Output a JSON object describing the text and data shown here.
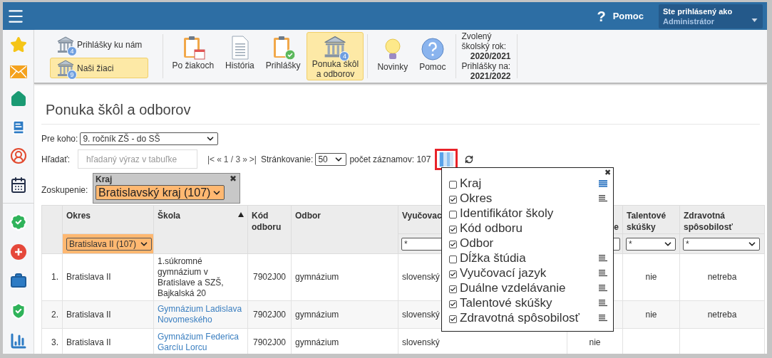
{
  "header": {
    "help_icon": "?",
    "help": "Pomoc",
    "user_label": "Ste prihlásený ako",
    "user_name": "Administrátor"
  },
  "toolbar": {
    "small_items": [
      {
        "label": "Prihlášky ku nám",
        "badge": "4",
        "selected": false
      },
      {
        "label": "Naši žiaci",
        "badge": "9",
        "selected": true
      }
    ],
    "large_items": [
      {
        "label": "Po žiakoch",
        "selected": false
      },
      {
        "label": "História",
        "selected": false
      },
      {
        "label": "Prihlášky",
        "selected": false
      },
      {
        "label": "Ponuka škôl a odborov",
        "badge": "4",
        "selected": true
      },
      {
        "label": "Novinky",
        "selected": false
      },
      {
        "label": "Pomoc",
        "selected": false
      }
    ],
    "year": {
      "label": "Zvolený školský rok:",
      "value": "2020/2021",
      "apply_label": "Prihlášky na:",
      "apply_value": "2021/2022"
    }
  },
  "page_title": "Ponuka škôl a odborov",
  "for_whom": {
    "label": "Pre koho:",
    "value": "9. ročník ZŠ - do SŠ"
  },
  "search": {
    "label": "Hľadať:",
    "placeholder": "hľadaný výraz v tabuľke"
  },
  "pager": {
    "first": "|<",
    "prev": "«",
    "pages": "1 / 3",
    "next": "»",
    "last": ">|",
    "page_size_label": "Stránkovanie:",
    "page_size": "50",
    "count": "počet záznamov: 107"
  },
  "grouping": {
    "label": "Zoskupenie:",
    "group_name": "Kraj",
    "close": "✖",
    "value": "Bratislavský kraj (107)"
  },
  "table": {
    "columns": [
      "Okres",
      "Škola",
      "Kód odboru",
      "Odbor",
      "Vyučovac",
      "e",
      "Talentové skúšky",
      "Zdravotná spôsobilosť"
    ],
    "okres_filter": "Bratislava II (107)",
    "filters": [
      "*",
      "*",
      "*"
    ],
    "rows": [
      {
        "num": "1.",
        "okres": "Bratislava II",
        "skola": "1.súkromné gymnázium v Bratislave a SZŠ, Bajkalská 20",
        "link": false,
        "kod": "7902J00",
        "odbor": "gymnázium",
        "jazyk": "slovenský",
        "talentove": "nie",
        "zdravotna": "netreba"
      },
      {
        "num": "2.",
        "okres": "Bratislava II",
        "skola": "Gymnázium Ladislava Novomeského",
        "link": true,
        "kod": "7902J00",
        "odbor": "gymnázium",
        "jazyk": "slovenský",
        "talentove": "nie",
        "zdravotna": "netreba"
      },
      {
        "num": "3.",
        "okres": "Bratislava II",
        "skola": "Gymnázium Federica Garcíu Lorcu",
        "link": true,
        "kod": "7902J00",
        "odbor": "gymnázium",
        "jazyk": "slovenský",
        "dualne": "nie"
      }
    ]
  },
  "column_chooser": {
    "close": "✖",
    "items": [
      {
        "label": "Kraj",
        "checked": false,
        "kind": "grouped"
      },
      {
        "label": "Okres",
        "checked": true,
        "kind": "groupable"
      },
      {
        "label": "Identifikátor školy",
        "checked": false,
        "kind": "plain"
      },
      {
        "label": "Kód odboru",
        "checked": true,
        "kind": "plain"
      },
      {
        "label": "Odbor",
        "checked": true,
        "kind": "plain"
      },
      {
        "label": "Dĺžka štúdia",
        "checked": false,
        "kind": "groupable"
      },
      {
        "label": "Vyučovací jazyk",
        "checked": true,
        "kind": "groupable"
      },
      {
        "label": "Duálne vzdelávanie",
        "checked": true,
        "kind": "groupable"
      },
      {
        "label": "Talentové skúšky",
        "checked": true,
        "kind": "groupable"
      },
      {
        "label": "Zdravotná spôsobilosť",
        "checked": true,
        "kind": "groupable"
      }
    ]
  }
}
